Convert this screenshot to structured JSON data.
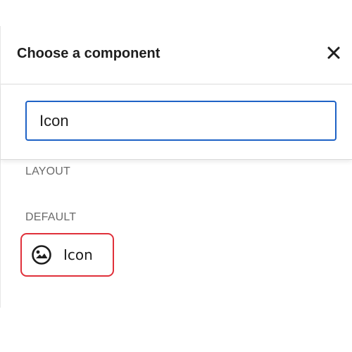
{
  "dialog": {
    "title": "Choose a component",
    "close_icon": "close-icon"
  },
  "search": {
    "value": "Icon",
    "placeholder": ""
  },
  "sections": {
    "layout": {
      "heading": "LAYOUT"
    },
    "default": {
      "heading": "DEFAULT",
      "items": [
        {
          "label": "Icon",
          "icon": "image-circle-icon"
        }
      ]
    }
  },
  "colors": {
    "accent": "#1e62c6",
    "highlight": "#e0303a",
    "text": "#1e1e1e",
    "muted": "#6b6b6b"
  }
}
